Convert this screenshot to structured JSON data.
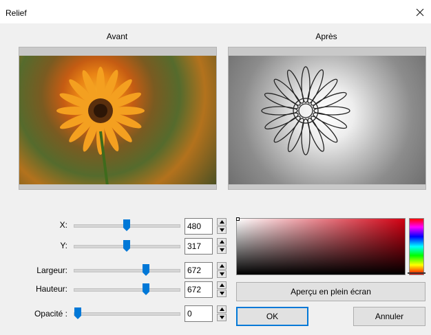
{
  "window": {
    "title": "Relief"
  },
  "panels": {
    "before_label": "Avant",
    "after_label": "Après"
  },
  "sliders": [
    {
      "label": "X:",
      "value": "480",
      "level": 0.5
    },
    {
      "label": "Y:",
      "value": "317",
      "level": 0.5
    },
    {
      "label": "Largeur:",
      "value": "672",
      "level": 0.66
    },
    {
      "label": "Hauteur:",
      "value": "672",
      "level": 0.66
    },
    {
      "label": "Opacité :",
      "value": "0",
      "level": 0.0
    }
  ],
  "color_picker": {
    "hue_color": "#d20012"
  },
  "buttons": {
    "fullscreen_preview": "Aperçu en plein écran",
    "ok": "OK",
    "cancel": "Annuler"
  }
}
